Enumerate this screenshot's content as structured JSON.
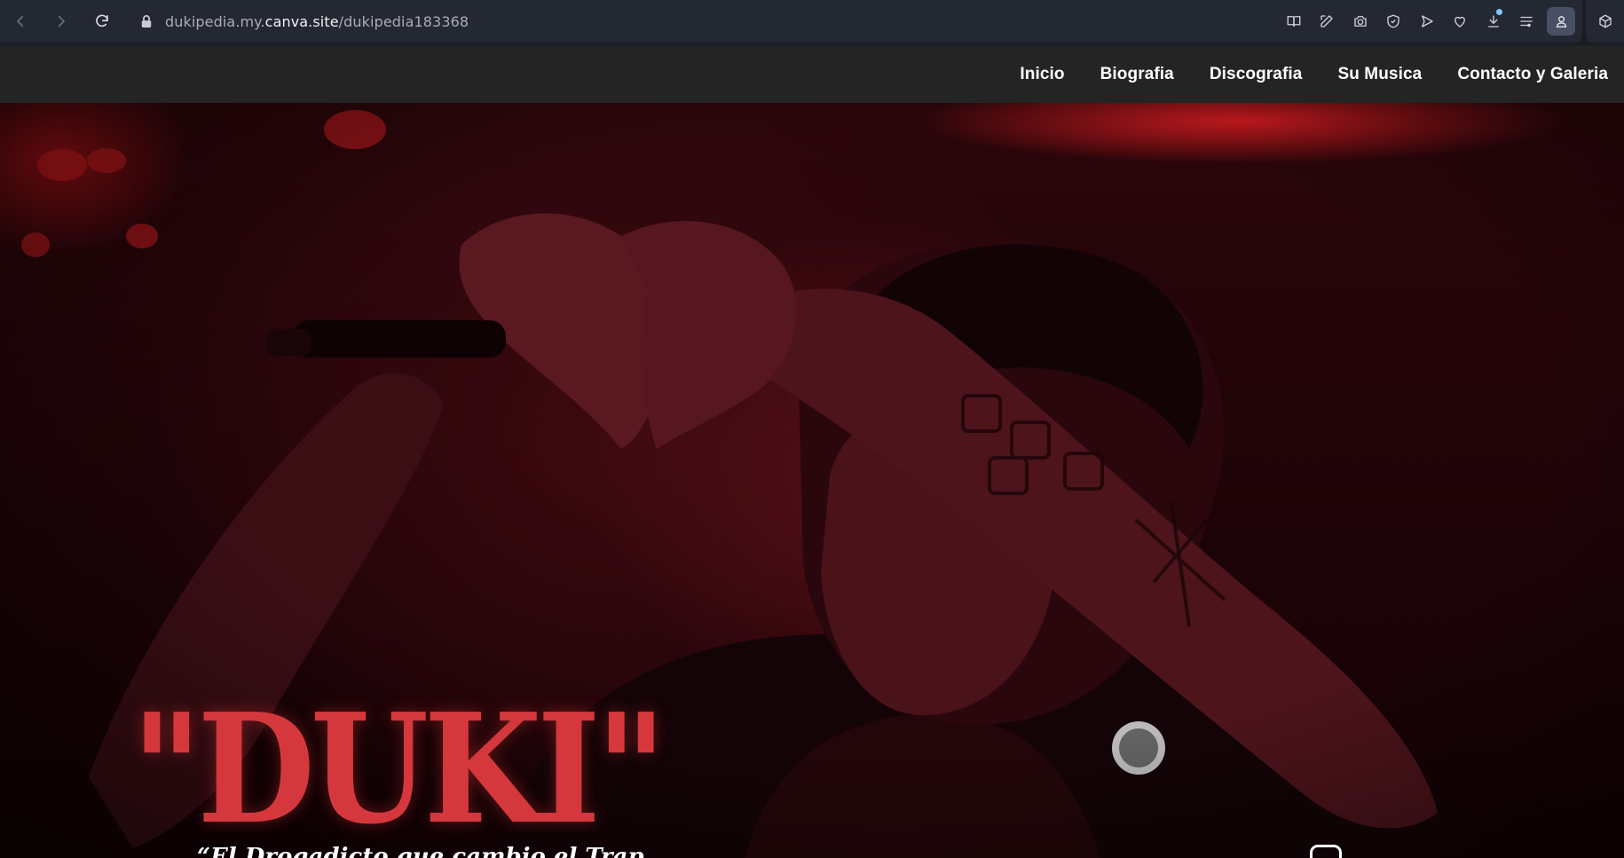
{
  "browser": {
    "url_host_prefix": "dukipedia.my.",
    "url_host": "canva.site",
    "url_path": "/dukipedia183368",
    "icons": [
      "reader-view-icon",
      "edit-icon",
      "camera-icon",
      "shield-icon",
      "send-icon",
      "heart-icon",
      "download-icon",
      "menu-icon",
      "profile-icon",
      "extensions-icon"
    ]
  },
  "site": {
    "nav": [
      {
        "label": "Inicio"
      },
      {
        "label": "Biografia"
      },
      {
        "label": "Discografia"
      },
      {
        "label": "Su Musica"
      },
      {
        "label": "Contacto y Galeria"
      }
    ]
  },
  "hero": {
    "title": "\"DUKI\"",
    "subtitle": "“El Drogadicto que cambio el Trap",
    "title_color": "#d4383c",
    "accent_red": "#e01e23"
  }
}
